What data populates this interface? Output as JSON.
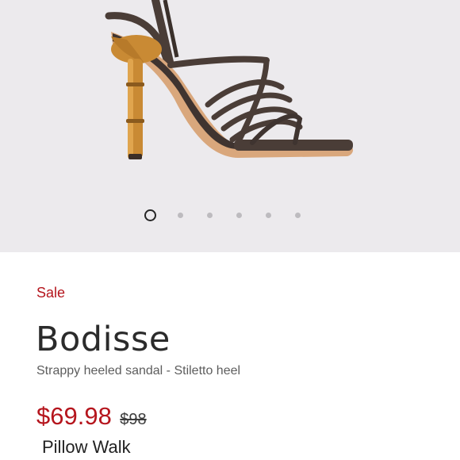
{
  "gallery": {
    "image_alt": "Brown strappy heeled sandal with bamboo-style stiletto heel",
    "slide_count": 6,
    "active_slide": 1
  },
  "product": {
    "badge": "Sale",
    "name": "Bodisse",
    "description": "Strappy heeled sandal - Stiletto heel",
    "sale_price": "$69.98",
    "original_price": "$98",
    "feature": "Pillow Walk"
  },
  "colors": {
    "sale_red": "#b5151d",
    "gallery_bg": "#eceaed",
    "strap_brown": "#4a3d37",
    "heel_amber": "#c98a34"
  }
}
